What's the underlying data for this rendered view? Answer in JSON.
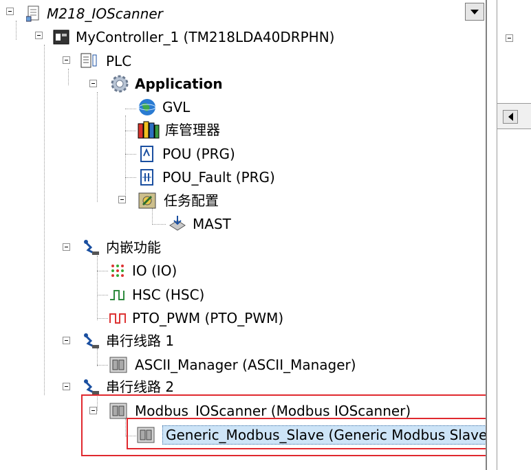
{
  "tree": {
    "root": "M218_IOScanner",
    "controller": "MyController_1 (TM218LDA40DRPHN)",
    "plc": "PLC",
    "application": "Application",
    "gvl": "GVL",
    "library_manager": "库管理器",
    "pou": "POU (PRG)",
    "pou_fault": "POU_Fault (PRG)",
    "task_config": "任务配置",
    "mast": "MAST",
    "embedded": "内嵌功能",
    "io": "IO (IO)",
    "hsc": "HSC (HSC)",
    "pto": "PTO_PWM (PTO_PWM)",
    "serial1": "串行线路 1",
    "ascii": "ASCII_Manager (ASCII_Manager)",
    "serial2": "串行线路 2",
    "modbus_scanner": "Modbus_IOScanner (Modbus IOScanner)",
    "modbus_slave": "Generic_Modbus_Slave (Generic Modbus Slave)"
  },
  "colors": {
    "highlight_box": "#e0282e",
    "selection": "#cde4f7"
  }
}
